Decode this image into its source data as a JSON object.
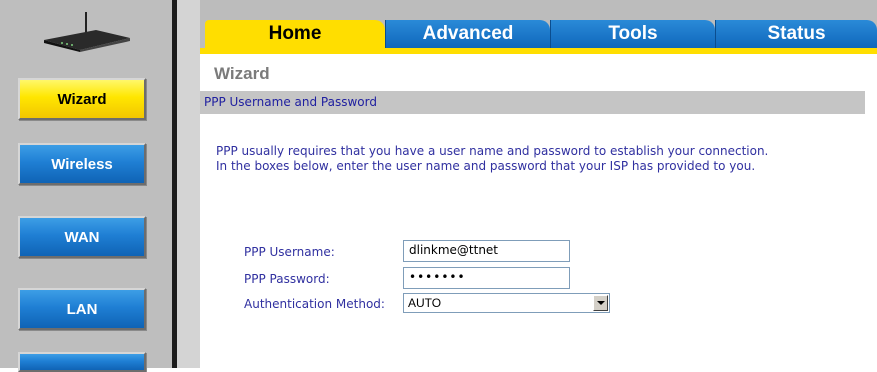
{
  "sidebar": {
    "items": [
      {
        "label": "Wizard",
        "active": true
      },
      {
        "label": "Wireless",
        "active": false
      },
      {
        "label": "WAN",
        "active": false
      },
      {
        "label": "LAN",
        "active": false
      }
    ]
  },
  "tabs": [
    {
      "label": "Home",
      "active": true
    },
    {
      "label": "Advanced",
      "active": false
    },
    {
      "label": "Tools",
      "active": false
    },
    {
      "label": "Status",
      "active": false
    }
  ],
  "page": {
    "title": "Wizard",
    "section_title": "PPP Username and Password",
    "description_line1": "PPP usually requires that you have a user name and password to establish your connection.",
    "description_line2": "In the boxes below, enter the user name and password that your ISP has provided to you."
  },
  "form": {
    "username_label": "PPP Username:",
    "username_value": "dlinkme@ttnet",
    "password_label": "PPP Password:",
    "password_value": "•••••••",
    "auth_label": "Authentication Method:",
    "auth_value": "AUTO"
  },
  "colors": {
    "accent_yellow": "#ffde00",
    "accent_blue": "#1f7fd4",
    "label_text": "#3030a0"
  }
}
